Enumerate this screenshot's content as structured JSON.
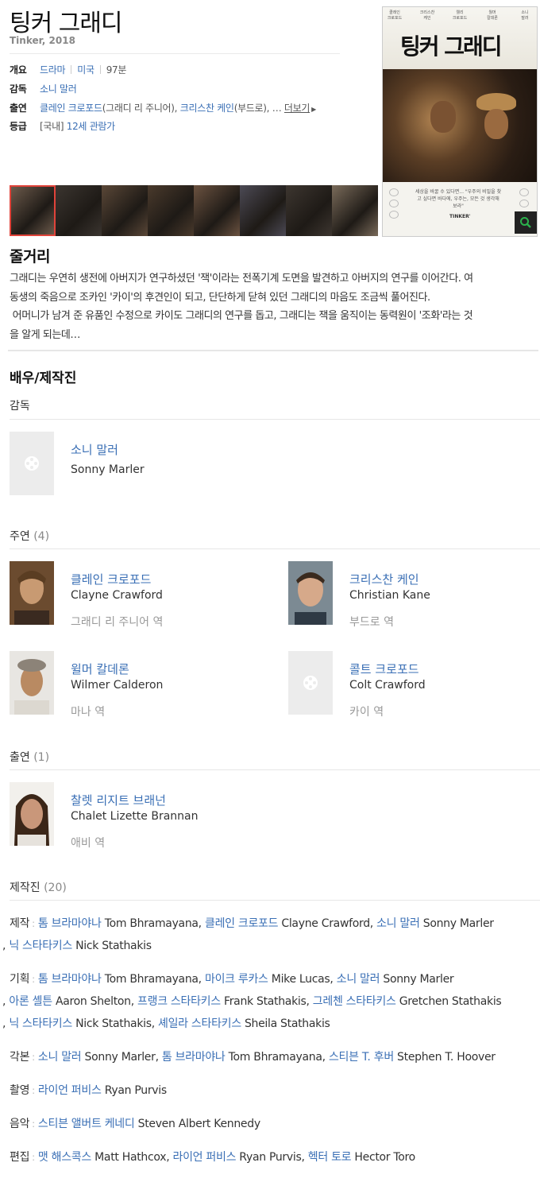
{
  "movie": {
    "title": "팅커 그래디",
    "subtitle": "Tinker, 2018"
  },
  "info": {
    "overview_label": "개요",
    "genre": "드라마",
    "country": "미국",
    "runtime": "97분",
    "director_label": "감독",
    "director": "소니 말러",
    "cast_label": "출연",
    "cast1": "클레인 크로포드",
    "cast1_role": "(그래디 리 주니어), ",
    "cast2": "크리스찬 케인",
    "cast2_role": "(부드로), … ",
    "more": "더보기",
    "rating_label": "등급",
    "rating_region": "[국내]",
    "rating": "12세 관람가"
  },
  "poster": {
    "credits": [
      "클레인\n크로포드",
      "크리스찬\n케인",
      "웰리\n크로포드",
      "월머\n칼데론",
      "소니\n말러"
    ],
    "title_text": "팅커 그래디",
    "tagline": "세상을 바꿀 수 있다면... \"우주의 비밀을 찾고 싶다면 바다에, 우주는, 모든 것 생각해 보라\"",
    "tinker_text": "TINKER'"
  },
  "stills": {
    "colors": [
      "#6c5a4b",
      "#3b3530",
      "#5a4737",
      "#4a3a2c",
      "#6b5240",
      "#4c4a55",
      "#3d3630",
      "#7a6b5a"
    ]
  },
  "plot": {
    "heading": "줄거리",
    "lines": [
      "그래디는 우연히 생전에 아버지가 연구하셨던 '잭'이라는 전폭기계 도면을 발견하고 아버지의 연구를 이어간다. 여",
      "동생의 죽음으로 조카인 '카이'의 후견인이 되고, 단단하게 닫혀 있던 그래디의 마음도 조금씩 풀어진다.",
      " 어머니가 남겨 준 유품인 수정으로 카이도 그래디의 연구를 돕고, 그래디는 잭을 움직이는 동력원이 '조화'라는 것",
      "을 알게 되는데…"
    ]
  },
  "cast": {
    "heading": "배우/제작진",
    "director_section": "감독",
    "director": {
      "ko": "소니 말러",
      "en": "Sonny Marler"
    },
    "main_section": "주연",
    "main_count": "(4)",
    "main": [
      {
        "ko": "클레인 크로포드",
        "en": "Clayne Crawford",
        "role": "그래디 리 주니어 역"
      },
      {
        "ko": "크리스찬 케인",
        "en": "Christian Kane",
        "role": "부드로 역"
      },
      {
        "ko": "윌머 칼데론",
        "en": "Wilmer Calderon",
        "role": "마나 역"
      },
      {
        "ko": "콜트 크로포드",
        "en": "Colt Crawford",
        "role": "카이 역"
      }
    ],
    "support_section": "출연",
    "support_count": "(1)",
    "support": [
      {
        "ko": "찰렛 리지트 브래넌",
        "en": "Chalet Lizette Brannan",
        "role": "애비 역"
      }
    ]
  },
  "crew": {
    "section": "제작진",
    "count": "(20)",
    "rows": [
      {
        "label": "제작",
        "lines": [
          [
            [
              "a",
              "톰 브라마야나"
            ],
            [
              "t",
              " Tom Bhramayana, "
            ],
            [
              "a",
              "클레인 크로포드"
            ],
            [
              "t",
              " Clayne Crawford, "
            ],
            [
              "a",
              "소니 말러"
            ],
            [
              "t",
              " Sonny Marler"
            ]
          ],
          [
            [
              "t",
              ", "
            ],
            [
              "a",
              "닉 스타타키스"
            ],
            [
              "t",
              " Nick Stathakis"
            ]
          ]
        ]
      },
      {
        "label": "기획",
        "lines": [
          [
            [
              "a",
              "톰 브라마야나"
            ],
            [
              "t",
              " Tom Bhramayana, "
            ],
            [
              "a",
              "마이크 루카스"
            ],
            [
              "t",
              " Mike Lucas, "
            ],
            [
              "a",
              "소니 말러"
            ],
            [
              "t",
              " Sonny Marler"
            ]
          ],
          [
            [
              "t",
              ", "
            ],
            [
              "a",
              "아론 셸튼"
            ],
            [
              "t",
              " Aaron Shelton, "
            ],
            [
              "a",
              "프랭크 스타타키스"
            ],
            [
              "t",
              " Frank Stathakis, "
            ],
            [
              "a",
              "그레첸 스타타키스"
            ],
            [
              "t",
              " Gretchen Stathakis"
            ]
          ],
          [
            [
              "t",
              ", "
            ],
            [
              "a",
              "닉 스타타키스"
            ],
            [
              "t",
              " Nick Stathakis, "
            ],
            [
              "a",
              "셰일라 스타타키스"
            ],
            [
              "t",
              " Sheila Stathakis"
            ]
          ]
        ]
      },
      {
        "label": "각본",
        "lines": [
          [
            [
              "a",
              "소니 말러"
            ],
            [
              "t",
              " Sonny Marler, "
            ],
            [
              "a",
              "톰 브라마야나"
            ],
            [
              "t",
              " Tom Bhramayana, "
            ],
            [
              "a",
              "스티븐 T. 후버"
            ],
            [
              "t",
              " Stephen T. Hoover"
            ]
          ]
        ]
      },
      {
        "label": "촬영",
        "lines": [
          [
            [
              "a",
              "라이언 퍼비스"
            ],
            [
              "t",
              " Ryan Purvis"
            ]
          ]
        ]
      },
      {
        "label": "음악",
        "lines": [
          [
            [
              "a",
              "스티븐 앨버트 케네디"
            ],
            [
              "t",
              " Steven Albert Kennedy"
            ]
          ]
        ]
      },
      {
        "label": "편집",
        "lines": [
          [
            [
              "a",
              "맷 해스콕스"
            ],
            [
              "t",
              " Matt Hathcox, "
            ],
            [
              "a",
              "라이언 퍼비스"
            ],
            [
              "t",
              " Ryan Purvis, "
            ],
            [
              "a",
              "헥터 토로"
            ],
            [
              "t",
              " Hector Toro"
            ]
          ]
        ]
      }
    ]
  }
}
